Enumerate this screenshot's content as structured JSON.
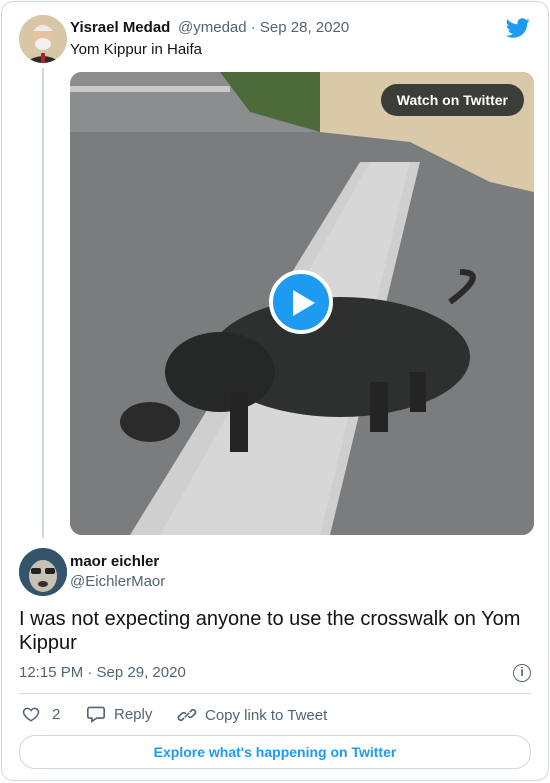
{
  "quoted": {
    "name": "Yisrael Medad",
    "handle_date": "@ymedad · Sep 28, 2020",
    "text": "Yom Kippur in Haifa"
  },
  "media": {
    "watch_label": "Watch on Twitter"
  },
  "reply": {
    "name": "maor eichler",
    "handle": "@EichlerMaor",
    "text": "I was not expecting anyone to use the crosswalk on Yom Kippur",
    "timestamp": "12:15 PM · Sep 29, 2020"
  },
  "actions": {
    "like_count": "2",
    "reply_label": "Reply",
    "copy_label": "Copy link to Tweet"
  },
  "footer": {
    "explore_label": "Explore what's happening on Twitter"
  },
  "colors": {
    "accent": "#1d9bf0",
    "muted": "#536471",
    "border": "#cfd9de"
  }
}
